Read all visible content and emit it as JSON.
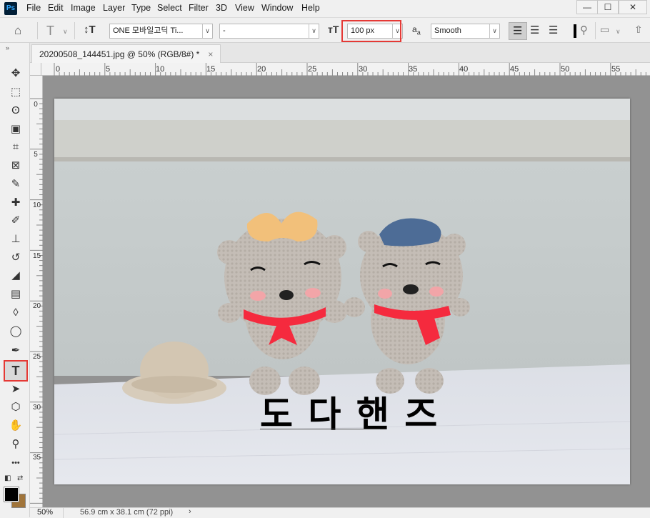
{
  "menu": [
    "File",
    "Edit",
    "Image",
    "Layer",
    "Type",
    "Select",
    "Filter",
    "3D",
    "View",
    "Window",
    "Help"
  ],
  "app_logo": "Ps",
  "window_controls": {
    "minimize": "—",
    "maximize": "☐",
    "close": "✕"
  },
  "options": {
    "font_family": "ONE 모바일고딕 Ti...",
    "font_style": "-",
    "font_size": "100 px",
    "antialias_icon_text": "a",
    "antialias": "Smooth",
    "highlight_color": "#e53935"
  },
  "document": {
    "tab_title": "20200508_144451.jpg @ 50% (RGB/8#) *",
    "close": "×",
    "text_layer": "도 다 핸 즈"
  },
  "rulers": {
    "h": [
      "0",
      "5",
      "10",
      "15",
      "20",
      "25",
      "30",
      "35",
      "40",
      "45",
      "50",
      "55"
    ],
    "v": [
      "0",
      "5",
      "10",
      "15",
      "20",
      "25",
      "30",
      "35"
    ]
  },
  "tools": [
    {
      "name": "move-tool",
      "icon": "✥"
    },
    {
      "name": "marquee-tool",
      "icon": "⬚"
    },
    {
      "name": "lasso-tool",
      "icon": "ʘ"
    },
    {
      "name": "object-select-tool",
      "icon": "▣"
    },
    {
      "name": "crop-tool",
      "icon": "⌗"
    },
    {
      "name": "frame-tool",
      "icon": "⊠"
    },
    {
      "name": "eyedropper-tool",
      "icon": "✎"
    },
    {
      "name": "healing-brush-tool",
      "icon": "✚"
    },
    {
      "name": "brush-tool",
      "icon": "✐"
    },
    {
      "name": "clone-stamp-tool",
      "icon": "⊥"
    },
    {
      "name": "history-brush-tool",
      "icon": "↺"
    },
    {
      "name": "eraser-tool",
      "icon": "◢"
    },
    {
      "name": "gradient-tool",
      "icon": "▤"
    },
    {
      "name": "blur-tool",
      "icon": "◊"
    },
    {
      "name": "dodge-tool",
      "icon": "◯"
    },
    {
      "name": "pen-tool",
      "icon": "✒"
    },
    {
      "name": "type-tool",
      "icon": "T"
    },
    {
      "name": "path-selection-tool",
      "icon": "➤"
    },
    {
      "name": "shape-tool",
      "icon": "⬡"
    },
    {
      "name": "hand-tool",
      "icon": "✋"
    },
    {
      "name": "zoom-tool",
      "icon": "⚲"
    },
    {
      "name": "more-tools",
      "icon": "•••"
    }
  ],
  "colors": {
    "foreground": "#000000",
    "background": "#a0743a"
  },
  "status": {
    "zoom": "50%",
    "info": "56.9 cm x 38.1 cm (72 ppi)",
    "arrow": "›"
  }
}
